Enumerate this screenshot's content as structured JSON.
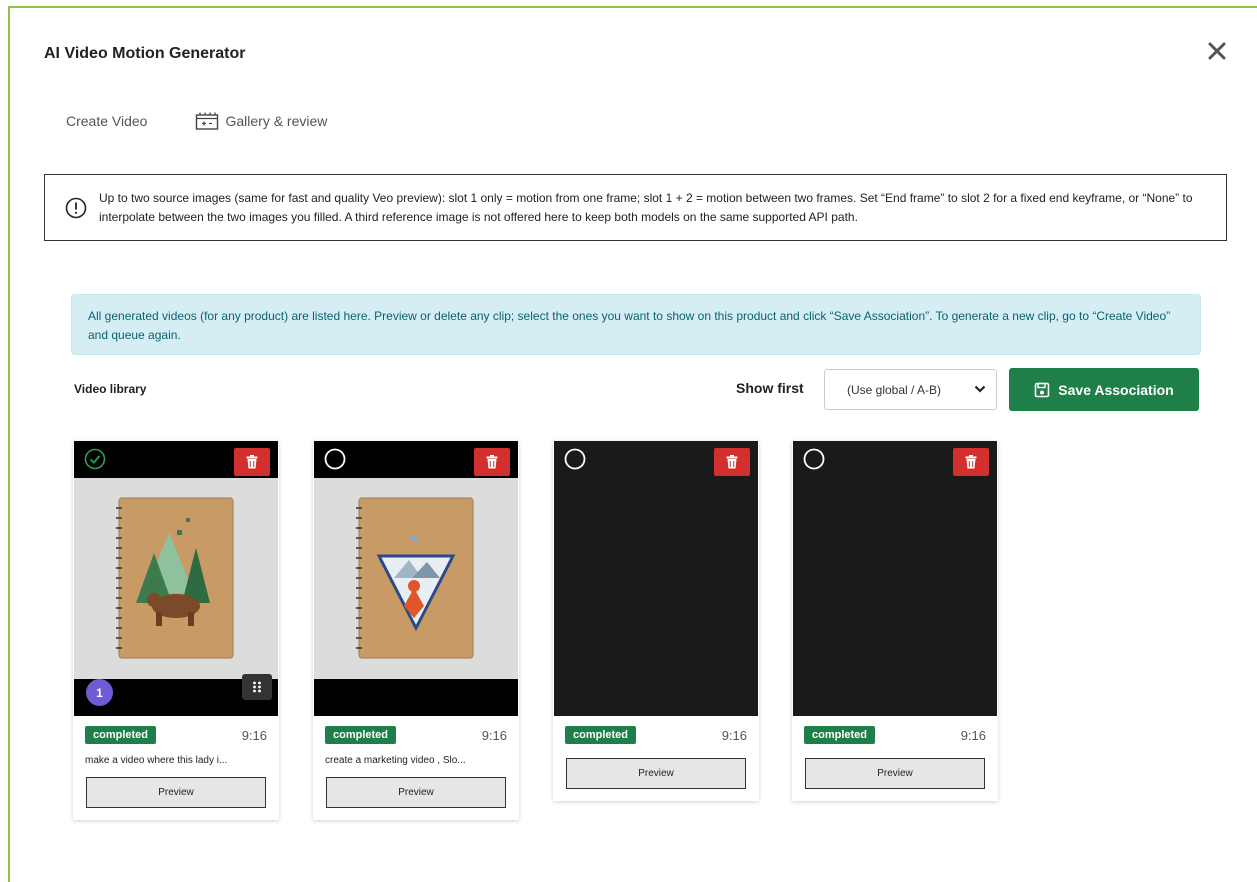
{
  "modal": {
    "title": "AI Video Motion Generator"
  },
  "tabs": {
    "create": "Create Video",
    "gallery": "Gallery & review"
  },
  "info": {
    "text": "Up to two source images (same for fast and quality Veo preview): slot 1 only = motion from one frame; slot 1 + 2 = motion between two frames. Set “End frame” to slot 2 for a fixed end keyframe, or “None” to interpolate between the two images you filled. A third reference image is not offered here to keep both models on the same supported API path."
  },
  "alert": {
    "text": "All generated videos (for any product) are listed here. Preview or delete any clip; select the ones you want to show on this product and click “Save Association”. To generate a new clip, go to “Create Video” and queue again."
  },
  "library": {
    "label": "Video library",
    "show_first_label": "Show first",
    "show_first_value": "(Use global / A-B)",
    "save_label": "Save Association"
  },
  "videos": [
    {
      "status": "completed",
      "ratio": "9:16",
      "prompt": "make a video where this lady i...",
      "preview": "Preview",
      "order": "1",
      "selected": true
    },
    {
      "status": "completed",
      "ratio": "9:16",
      "prompt": "create a marketing video , Slo...",
      "preview": "Preview",
      "selected": false
    },
    {
      "status": "completed",
      "ratio": "9:16",
      "prompt": "",
      "preview": "Preview",
      "selected": false
    },
    {
      "status": "completed",
      "ratio": "9:16",
      "prompt": "",
      "preview": "Preview",
      "selected": false
    }
  ],
  "colors": {
    "accent_green": "#1e8048",
    "danger_red": "#d32f2f",
    "badge_purple": "#6f5bd6",
    "frame_border": "#8bc34a",
    "alert_bg": "#d5eef3"
  }
}
